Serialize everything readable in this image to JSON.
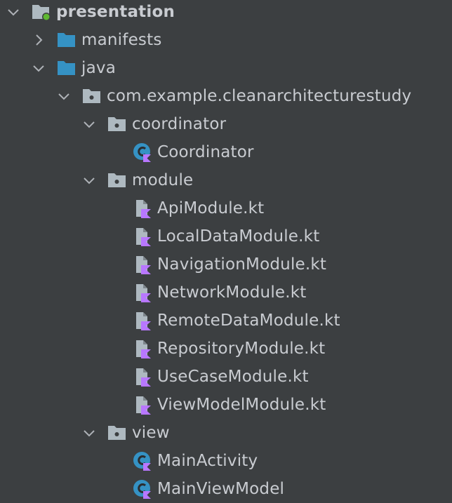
{
  "colors": {
    "background": "#3c3f41",
    "text": "#c9ccd1",
    "folder_blue": "#3592c4",
    "folder_gray": "#aeb9c0",
    "kotlin_purple": "#b877ff",
    "class_teal": "#3592c4",
    "module_badge_green": "#5fb832",
    "chevron": "#aeb2b7"
  },
  "tree": {
    "root": {
      "label": "presentation",
      "icon": "module-folder-icon",
      "expanded": true
    },
    "manifests": {
      "label": "manifests",
      "icon": "folder-icon",
      "expanded": false
    },
    "java": {
      "label": "java",
      "icon": "folder-icon",
      "expanded": true
    },
    "package": {
      "label": "com.example.cleanarchitecturestudy",
      "icon": "package-icon",
      "expanded": true
    },
    "coordinator_pkg": {
      "label": "coordinator",
      "icon": "package-icon",
      "expanded": true
    },
    "coordinator_class": {
      "label": "Coordinator",
      "icon": "kotlin-class-icon"
    },
    "module_pkg": {
      "label": "module",
      "icon": "package-icon",
      "expanded": true
    },
    "files": [
      {
        "label": "ApiModule.kt",
        "icon": "kotlin-file-icon"
      },
      {
        "label": "LocalDataModule.kt",
        "icon": "kotlin-file-icon"
      },
      {
        "label": "NavigationModule.kt",
        "icon": "kotlin-file-icon"
      },
      {
        "label": "NetworkModule.kt",
        "icon": "kotlin-file-icon"
      },
      {
        "label": "RemoteDataModule.kt",
        "icon": "kotlin-file-icon"
      },
      {
        "label": "RepositoryModule.kt",
        "icon": "kotlin-file-icon"
      },
      {
        "label": "UseCaseModule.kt",
        "icon": "kotlin-file-icon"
      },
      {
        "label": "ViewModelModule.kt",
        "icon": "kotlin-file-icon"
      }
    ],
    "view_pkg": {
      "label": "view",
      "icon": "package-icon",
      "expanded": true
    },
    "view_classes": [
      {
        "label": "MainActivity",
        "icon": "kotlin-class-icon"
      },
      {
        "label": "MainViewModel",
        "icon": "kotlin-class-icon"
      }
    ]
  }
}
